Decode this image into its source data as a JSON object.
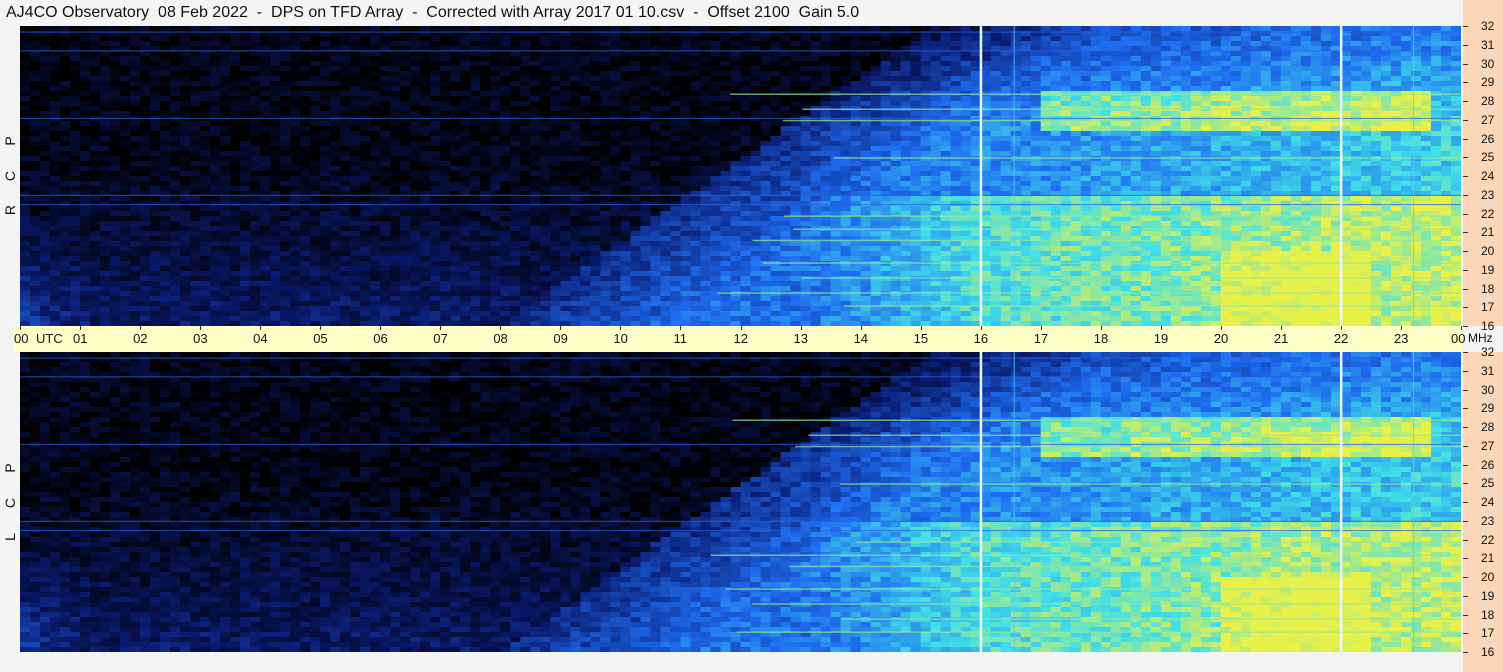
{
  "header": {
    "title": "AJ4CO Observatory  08 Feb 2022  -  DPS on TFD Array  -  Corrected with Array 2017 01 10.csv  -  Offset 2100  Gain 5.0"
  },
  "time_axis": {
    "labels": [
      "00",
      "01",
      "02",
      "03",
      "04",
      "05",
      "06",
      "07",
      "08",
      "09",
      "10",
      "11",
      "12",
      "13",
      "14",
      "15",
      "16",
      "17",
      "18",
      "19",
      "20",
      "21",
      "22",
      "23",
      "00"
    ],
    "utc_label": "UTC"
  },
  "freq_axis": {
    "unit": "MHz",
    "labels": [
      "32",
      "31",
      "30",
      "29",
      "28",
      "27",
      "26",
      "25",
      "24",
      "23",
      "22",
      "21",
      "20",
      "19",
      "18",
      "17",
      "16"
    ]
  },
  "panels": [
    {
      "id": "rcp",
      "letters": [
        "P",
        "C",
        "R"
      ]
    },
    {
      "id": "lcp",
      "letters": [
        "P",
        "C",
        "L"
      ]
    }
  ],
  "colors": {
    "background": "#000000",
    "low": "#0a1a6e",
    "mid": "#1e6cf0",
    "high": "#41e0e8",
    "peak": "#e8f04a",
    "axis_strip": "#ffffc8",
    "freq_strip": "#fbd6b9"
  },
  "chart_data": [
    {
      "type": "heatmap",
      "title": "",
      "x_axis": "Time (UTC hours)",
      "y_axis": "Frequency (MHz)",
      "xlim": [
        0,
        24
      ],
      "ylim": [
        16,
        32
      ],
      "polarization": "RCP",
      "bright_vertical_lines_utc": [
        16.0,
        22.0
      ],
      "notes": "Dynamic spectrum; strongest signal 13-24 UTC below 23 MHz"
    },
    {
      "type": "heatmap",
      "title": "",
      "x_axis": "Time (UTC hours)",
      "y_axis": "Frequency (MHz)",
      "xlim": [
        0,
        24
      ],
      "ylim": [
        16,
        32
      ],
      "polarization": "LCP",
      "bright_vertical_lines_utc": [
        16.0,
        22.0
      ],
      "notes": "Dynamic spectrum; strongest signal 13-24 UTC below 23 MHz"
    }
  ]
}
